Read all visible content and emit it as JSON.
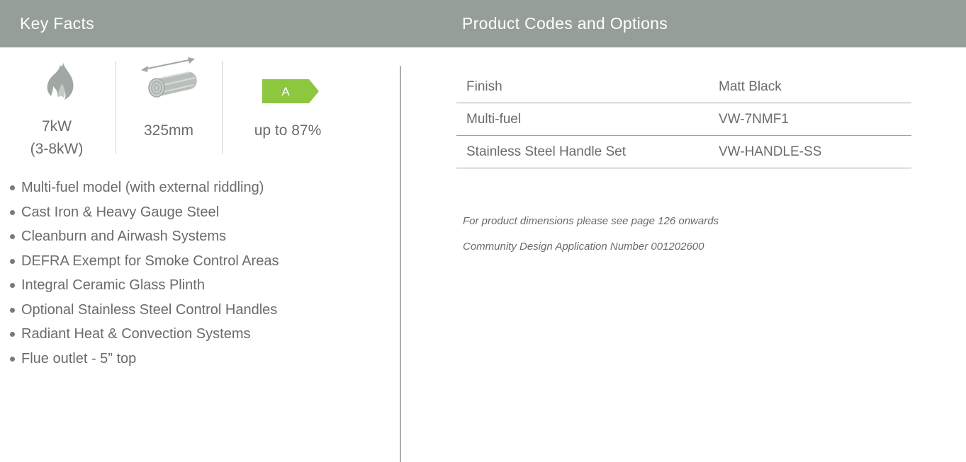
{
  "header": {
    "left_title": "Key Facts",
    "right_title": "Product Codes and Options"
  },
  "key_facts": {
    "heat_output": {
      "icon": "flame-icon",
      "value": "7kW",
      "range": "(3-8kW)"
    },
    "log_length": {
      "icon": "log-icon",
      "value": "325mm"
    },
    "efficiency": {
      "icon": "energy-rating-icon",
      "rating": "A",
      "rating_color": "#8dc63f",
      "value": "up to 87%"
    }
  },
  "features": [
    "Multi-fuel model (with external riddling)",
    "Cast Iron & Heavy Gauge Steel",
    "Cleanburn and Airwash Systems",
    "DEFRA Exempt for Smoke Control Areas",
    "Integral Ceramic Glass Plinth",
    "Optional Stainless Steel Control Handles",
    "Radiant Heat & Convection Systems",
    "Flue outlet - 5” top"
  ],
  "product_codes": [
    {
      "label": "Finish",
      "value": "Matt Black"
    },
    {
      "label": "Multi-fuel",
      "value": "VW-7NMF1"
    },
    {
      "label": "Stainless Steel Handle Set",
      "value": "VW-HANDLE-SS"
    }
  ],
  "notes": [
    "For product dimensions please see page 126 onwards",
    "Community Design Application Number 001202600"
  ],
  "colors": {
    "header_bg": "#969e98",
    "text": "#6b6b6b",
    "rating_green": "#8dc63f"
  }
}
